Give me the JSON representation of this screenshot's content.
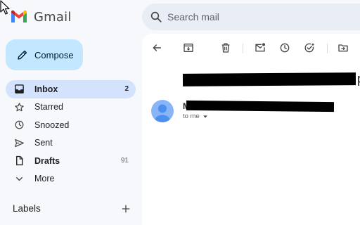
{
  "app": {
    "name": "Gmail"
  },
  "search": {
    "placeholder": "Search mail"
  },
  "compose": {
    "label": "Compose"
  },
  "nav": {
    "items": [
      {
        "label": "Inbox",
        "count": "2",
        "icon": "inbox-icon",
        "active": true
      },
      {
        "label": "Starred",
        "count": "",
        "icon": "star-icon"
      },
      {
        "label": "Snoozed",
        "count": "",
        "icon": "clock-icon"
      },
      {
        "label": "Sent",
        "count": "",
        "icon": "send-icon"
      },
      {
        "label": "Drafts",
        "count": "91",
        "icon": "draft-icon"
      },
      {
        "label": "More",
        "count": "",
        "icon": "chevron-down-icon"
      }
    ]
  },
  "labels": {
    "title": "Labels"
  },
  "message": {
    "subject_visible_tail": "p",
    "sender_initial": "M",
    "recipient": "to me"
  },
  "toolbar": {
    "icons": [
      "back-arrow-icon",
      "archive-icon",
      "delete-icon",
      "mark-unread-icon",
      "snooze-icon",
      "add-task-icon",
      "move-to-icon"
    ]
  },
  "colors": {
    "accent": "#c2e7ff",
    "active_nav": "#d3e3fd",
    "avatar": "#8ab4f8",
    "background": "#f6f8fc"
  }
}
